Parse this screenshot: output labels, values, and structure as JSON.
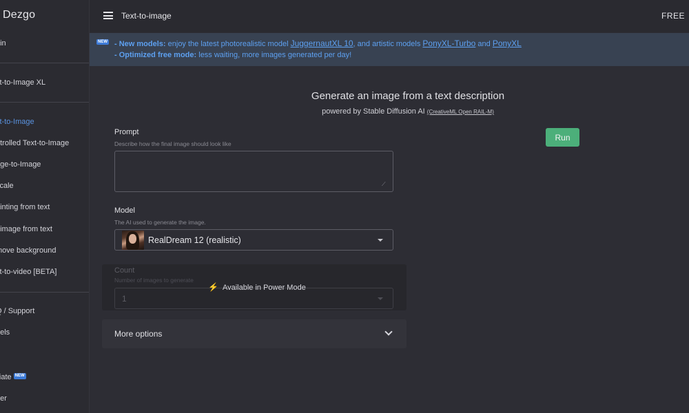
{
  "brand": "Dezgo",
  "topbar": {
    "title": "Text-to-image",
    "plan": "FREE"
  },
  "sidebar": {
    "items": [
      {
        "label": "gin",
        "active": false
      },
      {
        "label": "xt-to-Image XL",
        "active": false
      },
      {
        "label": "xt-to-Image",
        "active": true
      },
      {
        "label": "ntrolled Text-to-Image",
        "active": false
      },
      {
        "label": "age-to-Image",
        "active": false
      },
      {
        "label": "scale",
        "active": false
      },
      {
        "label": "ainting from text",
        "active": false
      },
      {
        "label": "t image from text",
        "active": false
      },
      {
        "label": "move background",
        "active": false
      },
      {
        "label": "xt-to-video [BETA]",
        "active": false
      },
      {
        "label": "Q / Support",
        "active": false
      },
      {
        "label": "dels",
        "active": false
      },
      {
        "label": "iliate",
        "active": false
      },
      {
        "label": "tter",
        "active": false
      }
    ],
    "new_badge": "NEW"
  },
  "announcement": {
    "badge": "NEW",
    "line1_bold": "- New models:",
    "line1_text": " enjoy the latest photorealistic model ",
    "line1_link1": "JuggernautXL 10",
    "line1_mid": ", and artistic models ",
    "line1_link2": "PonyXL-Turbo",
    "line1_and": " and ",
    "line1_link3": "PonyXL",
    "line2_bold": "- Optimized free mode:",
    "line2_text": " less waiting, more images generated per day!"
  },
  "main": {
    "title": "Generate an image from a text description",
    "subtitle": "powered by Stable Diffusion AI ",
    "license": "(CreativeML Open RAIL-M)",
    "prompt_label": "Prompt",
    "prompt_hint": "Describe how the final image should look like",
    "prompt_value": "",
    "run_label": "Run",
    "model_label": "Model",
    "model_hint": "The AI used to generate the image.",
    "model_selected": "RealDream 12 (realistic)",
    "count_label": "Count",
    "count_hint": "Number of images to generate",
    "count_value": "1",
    "power_mode": "Available in Power Mode",
    "more_options": "More options"
  },
  "colors": {
    "accent_blue": "#5da0f0",
    "run_green": "#4caf7a",
    "bolt_green": "#4caf7a"
  }
}
